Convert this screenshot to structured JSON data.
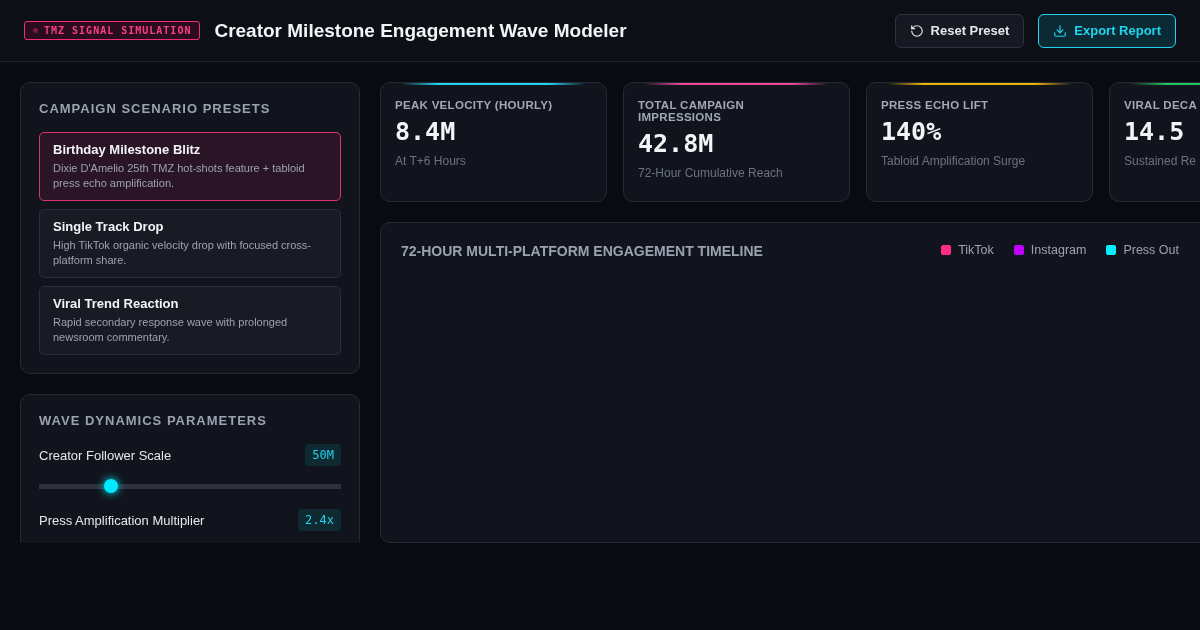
{
  "header": {
    "badge": "TMZ SIGNAL SIMULATION",
    "title": "Creator Milestone Engagement Wave Modeler",
    "buttons": [
      {
        "label": "Reset Preset",
        "kind": "reset"
      },
      {
        "label": "Export Report",
        "kind": "export"
      }
    ]
  },
  "presets": {
    "title": "CAMPAIGN SCENARIO PRESETS",
    "items": [
      {
        "name": "Birthday Milestone Blitz",
        "description": "Dixie D'Amelio 25th TMZ hot-shots feature + tabloid press echo amplification.",
        "selected": true
      },
      {
        "name": "Single Track Drop",
        "description": "High TikTok organic velocity drop with focused cross-platform share.",
        "selected": false
      },
      {
        "name": "Viral Trend Reaction",
        "description": "Rapid secondary response wave with prolonged newsroom commentary.",
        "selected": false
      }
    ]
  },
  "parameters": {
    "title": "WAVE DYNAMICS PARAMETERS",
    "items": [
      {
        "label": "Creator Follower Scale",
        "value": "50M",
        "level": 0.24
      },
      {
        "label": "Press Amplification Multiplier",
        "value": "2.4x"
      }
    ]
  },
  "metrics": [
    {
      "label": "PEAK VELOCITY (HOURLY)",
      "value": "8.4M",
      "caption": "At T+6 Hours",
      "color": "#22d3ee"
    },
    {
      "label": "TOTAL CAMPAIGN IMPRESSIONS",
      "value": "42.8M",
      "caption": "72-Hour Cumulative Reach",
      "color": "#ec4899"
    },
    {
      "label": "PRESS ECHO LIFT",
      "value": "140%",
      "caption": "Tabloid Amplification Surge",
      "color": "#eab308"
    },
    {
      "label": "VIRAL DECA",
      "value": "14.5",
      "caption": "Sustained Re",
      "color": "#22c55e"
    }
  ],
  "timeline": {
    "title": "72-HOUR MULTI-PLATFORM ENGAGEMENT TIMELINE",
    "legend": [
      {
        "label": "TikTok",
        "color": "#ff2d87"
      },
      {
        "label": "Instagram",
        "color": "#c000ff"
      },
      {
        "label": "Press Out",
        "color": "#00f0ff"
      }
    ]
  }
}
